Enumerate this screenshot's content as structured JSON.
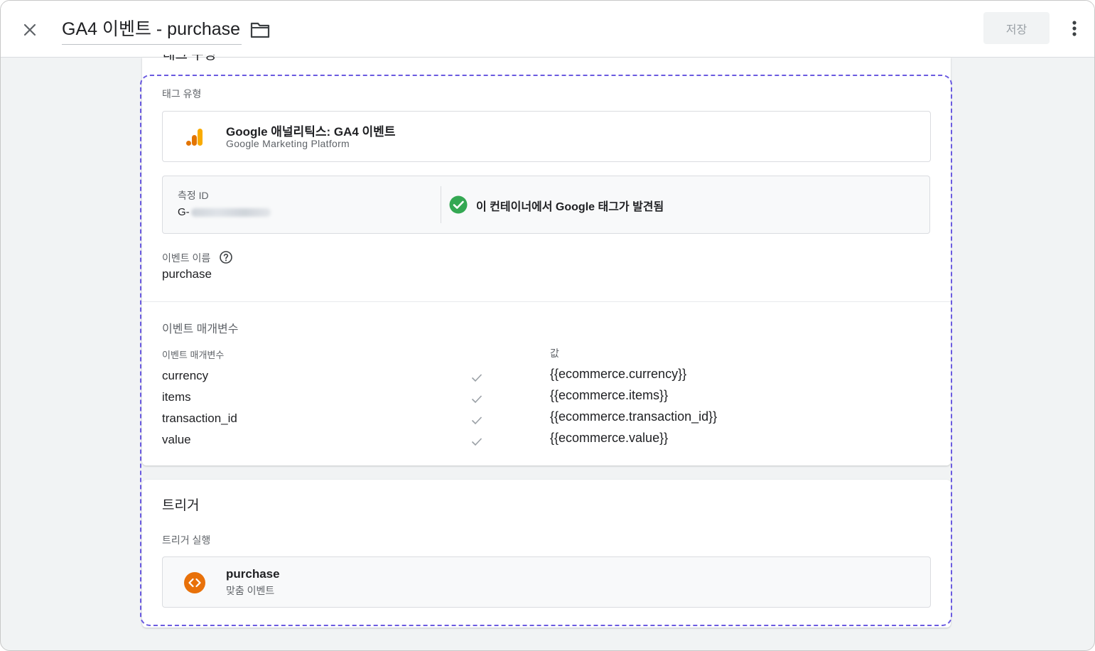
{
  "header": {
    "title": "GA4 이벤트 - purchase",
    "save_label": "저장"
  },
  "tag_config": {
    "section_heading": "태그 구성",
    "tag_type_label": "태그 유형",
    "tag_type": {
      "title": "Google 애널리틱스: GA4 이벤트",
      "subtitle": "Google Marketing Platform"
    },
    "measurement": {
      "label": "측정 ID",
      "value_prefix": "G-",
      "status": "이 컨테이너에서 Google 태그가 발견됨"
    },
    "event_name": {
      "label": "이벤트 이름",
      "value": "purchase"
    },
    "event_params": {
      "heading": "이벤트 매개변수",
      "param_col_label": "이벤트 매개변수",
      "value_col_label": "값",
      "rows": [
        {
          "name": "currency",
          "value": "{{ecommerce.currency}}"
        },
        {
          "name": "items",
          "value": "{{ecommerce.items}}"
        },
        {
          "name": "transaction_id",
          "value": "{{ecommerce.transaction_id}}"
        },
        {
          "name": "value",
          "value": "{{ecommerce.value}}"
        }
      ]
    }
  },
  "trigger": {
    "heading": "트리거",
    "label": "트리거 실행",
    "item": {
      "name": "purchase",
      "type": "맞춤 이벤트"
    }
  },
  "colors": {
    "accent_dashed": "#6a5ae0",
    "success": "#34a853",
    "ga_orange": "#f9ab00",
    "ga_dark_orange": "#e37400",
    "trigger_orange": "#e8710a"
  },
  "icons": [
    "close-icon",
    "folder-icon",
    "more-vert-icon",
    "google-analytics-icon",
    "check-circle-icon",
    "help-icon",
    "check-icon",
    "custom-event-icon"
  ]
}
